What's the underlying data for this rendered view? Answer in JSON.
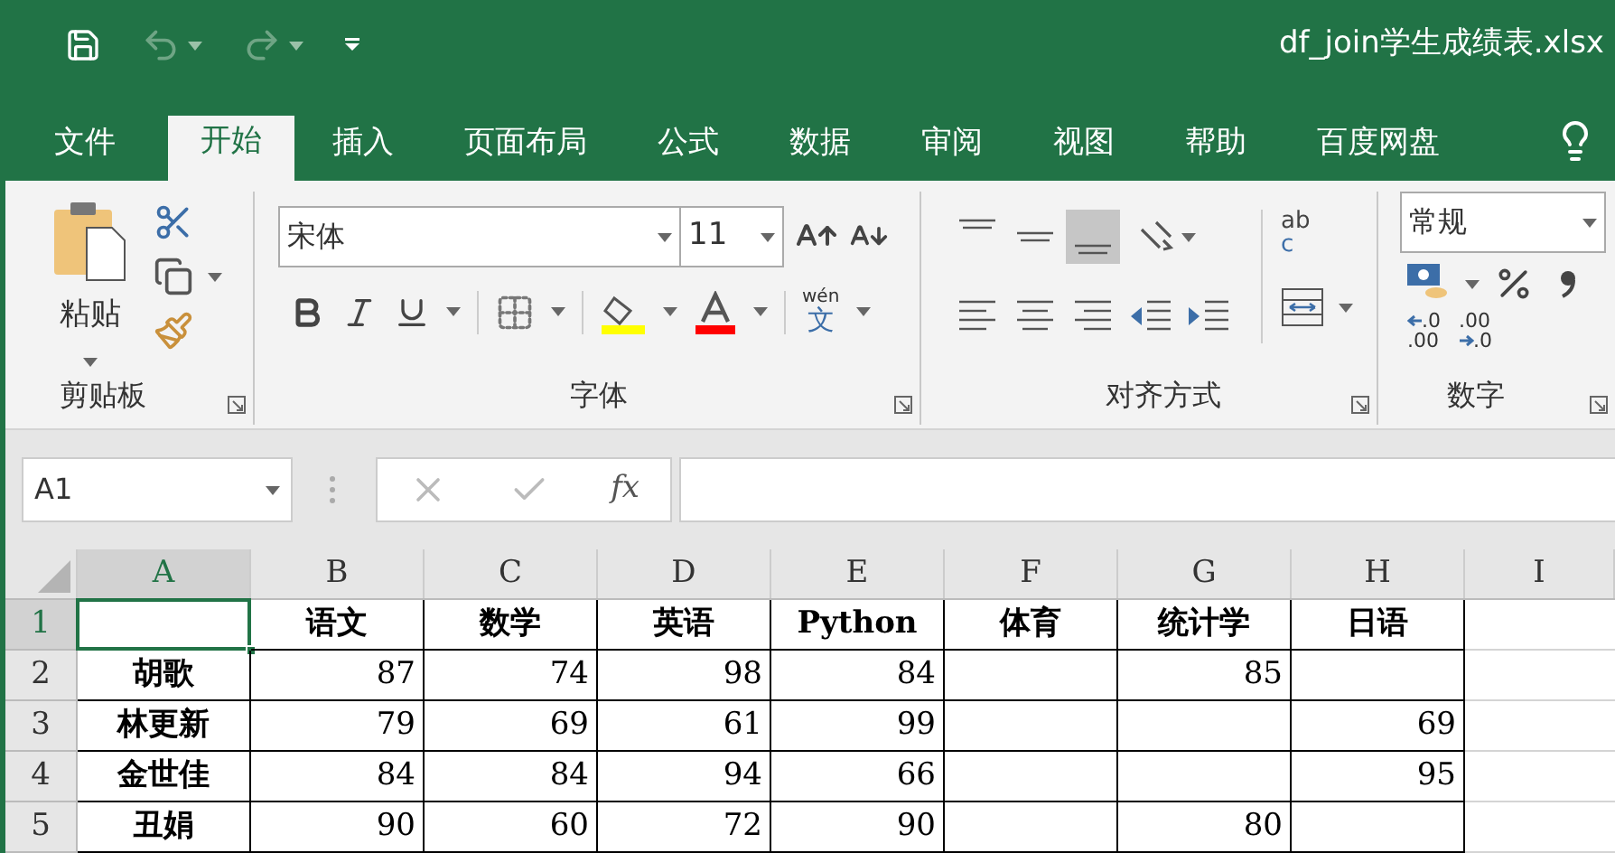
{
  "quick_access": [
    {
      "kind": "save",
      "disabled": false
    },
    {
      "kind": "undo",
      "disabled": true
    },
    {
      "kind": "redo",
      "disabled": true
    },
    {
      "kind": "customize",
      "disabled": false
    }
  ],
  "window": {
    "title": "df_join学生成绩表.xlsx"
  },
  "tabs": [
    {
      "label": "文件",
      "selected": false
    },
    {
      "label": "开始",
      "selected": true
    },
    {
      "label": "插入",
      "selected": false
    },
    {
      "label": "页面布局",
      "selected": false
    },
    {
      "label": "公式",
      "selected": false
    },
    {
      "label": "数据",
      "selected": false
    },
    {
      "label": "审阅",
      "selected": false
    },
    {
      "label": "视图",
      "selected": false
    },
    {
      "label": "帮助",
      "selected": false
    },
    {
      "label": "百度网盘",
      "selected": false
    }
  ],
  "ribbon": {
    "clipboard": {
      "title": "剪贴板",
      "paste_label": "粘贴"
    },
    "font": {
      "title": "字体",
      "font_name": "宋体",
      "font_size": "11",
      "phonetic_top": "wén",
      "phonetic_glyph": "文"
    },
    "alignment": {
      "title": "对齐方式",
      "wrap_top": "ab",
      "wrap_bottom": "c",
      "vertical": [
        {
          "kind": "top",
          "selected": false
        },
        {
          "kind": "middle",
          "selected": false
        },
        {
          "kind": "bottom",
          "selected": true
        }
      ]
    },
    "number": {
      "title": "数字",
      "format": "常规",
      "increase_decimal": [
        ".0",
        ".00"
      ],
      "decrease_decimal": [
        ".00",
        ".0"
      ]
    }
  },
  "formula_bar": {
    "name_box": "A1",
    "function_label": "fx"
  },
  "sheet": {
    "columns": [
      {
        "label": "A",
        "selected": true
      },
      {
        "label": "B",
        "selected": false
      },
      {
        "label": "C",
        "selected": false
      },
      {
        "label": "D",
        "selected": false
      },
      {
        "label": "E",
        "selected": false
      },
      {
        "label": "F",
        "selected": false
      },
      {
        "label": "G",
        "selected": false
      },
      {
        "label": "H",
        "selected": false
      },
      {
        "label": "I",
        "selected": false
      }
    ],
    "rows": [
      {
        "label": "1",
        "selected": true,
        "kind": "header",
        "cells": [
          null,
          "语文",
          "数学",
          "英语",
          "Python",
          "体育",
          "统计学",
          "日语"
        ]
      },
      {
        "label": "2",
        "selected": false,
        "kind": "data",
        "cells": [
          "胡歌",
          "87",
          "74",
          "98",
          "84",
          null,
          "85",
          null
        ]
      },
      {
        "label": "3",
        "selected": false,
        "kind": "data",
        "cells": [
          "林更新",
          "79",
          "69",
          "61",
          "99",
          null,
          null,
          "69"
        ]
      },
      {
        "label": "4",
        "selected": false,
        "kind": "data",
        "cells": [
          "金世佳",
          "84",
          "84",
          "94",
          "66",
          null,
          null,
          "95"
        ]
      },
      {
        "label": "5",
        "selected": false,
        "kind": "data",
        "cells": [
          "丑娟",
          "90",
          "60",
          "72",
          "90",
          null,
          "80",
          null
        ]
      }
    ]
  }
}
